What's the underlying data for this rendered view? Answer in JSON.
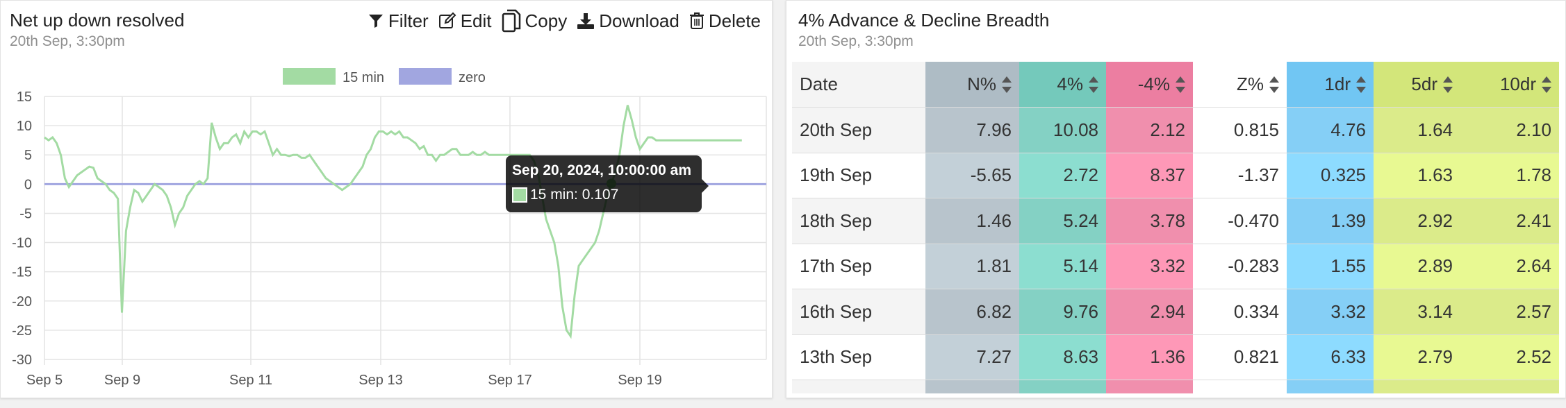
{
  "colors": {
    "series_15min": "#a3dba3",
    "zero_line": "#a1a6e0",
    "tooltip_bg": "#000000",
    "col_n": "#b8c4cc",
    "col_4": "#84d1c4",
    "col_m4": "#f08fad",
    "col_z": "#ffffff",
    "col_1dr": "#85cff6",
    "col_5dr": "#dbeb8a",
    "col_10dr": "#dbeb8a"
  },
  "chart_panel": {
    "title": "Net up down resolved",
    "subtitle": "20th Sep, 3:30pm",
    "toolbar": {
      "filter": "Filter",
      "edit": "Edit",
      "copy": "Copy",
      "download": "Download",
      "delete": "Delete"
    },
    "legend": [
      "15 min",
      "zero"
    ],
    "tooltip": {
      "title": "Sep 20, 2024, 10:00:00 am",
      "line": "15 min: 0.107"
    }
  },
  "chart_data": {
    "type": "line",
    "xlabel": "",
    "ylabel": "",
    "ylim": [
      -30,
      15
    ],
    "yticks": [
      15,
      10,
      5,
      0,
      -5,
      -10,
      -15,
      -20,
      -25,
      -30
    ],
    "xticks": [
      "Sep 5",
      "Sep 9",
      "Sep 11",
      "Sep 13",
      "Sep 17",
      "Sep 19"
    ],
    "grid": true,
    "legend_position": "top-center",
    "x": [
      0,
      0.2,
      0.4,
      0.6,
      0.8,
      1.0,
      1.2,
      1.4,
      1.6,
      1.8,
      2.0,
      2.2,
      2.4,
      2.6,
      2.8,
      3.0,
      3.2,
      3.4,
      3.6,
      3.8,
      4.0,
      4.2,
      4.4,
      4.6,
      4.8,
      5.0,
      5.2,
      5.4,
      5.6,
      5.8,
      6.0,
      6.2,
      6.4,
      6.6,
      6.8,
      7.0,
      7.2,
      7.4,
      7.6,
      7.8,
      8.0,
      8.2,
      8.4,
      8.6,
      8.8,
      9.0,
      9.2,
      9.4,
      9.6,
      9.8,
      10.0,
      10.2,
      10.4,
      10.6,
      10.8,
      11.0,
      11.2,
      11.4,
      11.6,
      11.8,
      12.0,
      12.2,
      12.4,
      12.6,
      12.8,
      13.0,
      13.2,
      13.4,
      13.6,
      13.8,
      14.0,
      14.2,
      14.4,
      14.6,
      14.8,
      15.0,
      15.2,
      15.4,
      15.6,
      15.8,
      16.0,
      16.2,
      16.4,
      16.6,
      16.8,
      17.0,
      17.2,
      17.4,
      17.6,
      17.8,
      18.0,
      18.2,
      18.4,
      18.6,
      18.8,
      19.0,
      19.2,
      19.4,
      19.6,
      19.8,
      20.0,
      20.2,
      20.4,
      20.6,
      20.8,
      21.0,
      21.2,
      21.4,
      21.6,
      21.8,
      22.0,
      22.2,
      22.4,
      22.6,
      22.8,
      23.0,
      23.2,
      23.4,
      23.6,
      23.8,
      24.0,
      24.2,
      24.4,
      24.6,
      24.8,
      25.0,
      25.2,
      25.4,
      25.6,
      25.8,
      26.0,
      26.2,
      26.4,
      26.6,
      26.8,
      27.0,
      27.2,
      27.4,
      27.6,
      27.8,
      28.0,
      28.2,
      28.4,
      28.6,
      28.8,
      29.0,
      29.2,
      29.4,
      29.6,
      29.8,
      30.0,
      30.2,
      30.4,
      30.6,
      30.8,
      31.0,
      31.2,
      31.4,
      31.6,
      31.8,
      32.0,
      32.2,
      32.4,
      32.6,
      32.8,
      33.0,
      33.2,
      33.4,
      33.6,
      33.8,
      34.0,
      34.2,
      34.4,
      34.6,
      34.8,
      35.0,
      35.2,
      35.4
    ],
    "series": [
      {
        "name": "15 min",
        "values": [
          8,
          7.5,
          8,
          7,
          5,
          1,
          -0.5,
          0.5,
          1.5,
          2,
          2.5,
          3,
          2.8,
          1,
          0.5,
          0,
          -1,
          -1.5,
          -2.5,
          -22,
          -8,
          -4,
          -1,
          -1.5,
          -3,
          -2,
          -1,
          0,
          -0.5,
          -1,
          -2,
          -4,
          -7,
          -5,
          -4,
          -2,
          -1,
          0,
          0.5,
          0,
          1,
          10.5,
          8,
          6,
          7,
          7,
          8,
          8.5,
          7,
          9,
          8,
          9,
          9,
          8.5,
          9,
          7,
          5,
          6,
          5,
          5,
          4.8,
          5,
          5,
          4.5,
          4.5,
          5,
          4,
          3,
          2,
          1,
          0.5,
          0,
          -0.5,
          -1,
          -0.5,
          0,
          1,
          2,
          3,
          5,
          6,
          8,
          9,
          9,
          8.5,
          9,
          8.5,
          9,
          8,
          8,
          7.5,
          7,
          6,
          6.5,
          5,
          5,
          4,
          5,
          5,
          5.5,
          6,
          6,
          5,
          5,
          5,
          5.5,
          5,
          5,
          5.5,
          5,
          5,
          5,
          5,
          5,
          5,
          5,
          5,
          5,
          5,
          5,
          4,
          2,
          -2,
          -6,
          -8,
          -10,
          -14,
          -21,
          -25,
          -26,
          -19,
          -14,
          -13,
          -12,
          -11,
          -10,
          -8,
          -5,
          -2,
          0.1,
          2,
          5,
          10,
          13.5,
          11,
          8,
          6,
          7,
          8,
          8,
          7.5,
          7.5,
          7.5,
          7.5,
          7.5,
          7.5,
          7.5,
          7.5,
          7.5,
          7.5,
          7.5,
          7.5,
          7.5,
          7.5,
          7.5,
          7.5,
          7.5,
          7.5,
          7.5,
          7.5,
          7.5,
          7.5
        ]
      },
      {
        "name": "zero",
        "values": "constant 0"
      }
    ]
  },
  "table_panel": {
    "title": "4% Advance & Decline Breadth",
    "subtitle": "20th Sep, 3:30pm",
    "columns": [
      "Date",
      "N%",
      "4%",
      "-4%",
      "Z%",
      "1dr",
      "5dr",
      "10dr"
    ],
    "rows": [
      [
        "20th Sep",
        "7.96",
        "10.08",
        "2.12",
        "0.815",
        "4.76",
        "1.64",
        "2.10"
      ],
      [
        "19th Sep",
        "-5.65",
        "2.72",
        "8.37",
        "-1.37",
        "0.325",
        "1.63",
        "1.78"
      ],
      [
        "18th Sep",
        "1.46",
        "5.24",
        "3.78",
        "-0.470",
        "1.39",
        "2.92",
        "2.41"
      ],
      [
        "17th Sep",
        "1.81",
        "5.14",
        "3.32",
        "-0.283",
        "1.55",
        "2.89",
        "2.64"
      ],
      [
        "16th Sep",
        "6.82",
        "9.76",
        "2.94",
        "0.334",
        "3.32",
        "3.14",
        "2.57"
      ],
      [
        "13th Sep",
        "7.27",
        "8.63",
        "1.36",
        "0.821",
        "6.33",
        "2.79",
        "2.52"
      ],
      [
        "",
        "",
        "",
        "",
        "",
        "",
        "",
        ""
      ]
    ]
  }
}
